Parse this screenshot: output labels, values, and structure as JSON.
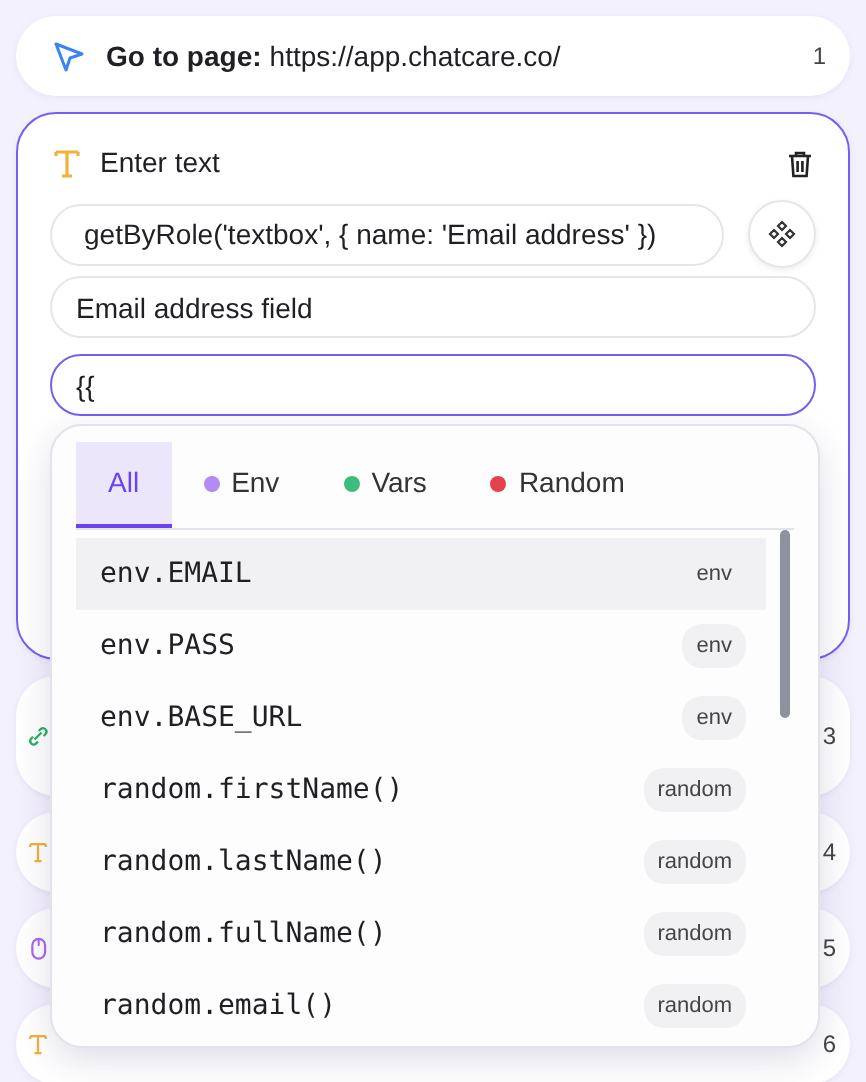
{
  "steps": [
    {
      "kind": "goto",
      "label": "Go to page:",
      "value": "https://app.chatcare.co/",
      "number": "1"
    },
    {
      "kind": "fill",
      "expanded": true,
      "title": "Enter text",
      "locator": "getByRole('textbox', { name: 'Email address' })",
      "description": "Email address field",
      "value": "{{"
    },
    {
      "kind": "link",
      "number": "3"
    },
    {
      "kind": "fill",
      "number": "4"
    },
    {
      "kind": "click",
      "number": "5"
    },
    {
      "kind": "fill",
      "number": "6"
    }
  ],
  "autocomplete": {
    "tabs": [
      {
        "label": "All",
        "selected": true
      },
      {
        "label": "Env",
        "selected": false,
        "color": "#b28cf6"
      },
      {
        "label": "Vars",
        "selected": false,
        "color": "#3dbd7d"
      },
      {
        "label": "Random",
        "selected": false,
        "color": "#e5404b"
      }
    ],
    "items": [
      {
        "name": "env.EMAIL",
        "tag": "env",
        "selected": true
      },
      {
        "name": "env.PASS",
        "tag": "env",
        "selected": false
      },
      {
        "name": "env.BASE_URL",
        "tag": "env",
        "selected": false
      },
      {
        "name": "random.firstName()",
        "tag": "random",
        "selected": false
      },
      {
        "name": "random.lastName()",
        "tag": "random",
        "selected": false
      },
      {
        "name": "random.fullName()",
        "tag": "random",
        "selected": false
      },
      {
        "name": "random.email()",
        "tag": "random",
        "selected": false
      }
    ]
  }
}
